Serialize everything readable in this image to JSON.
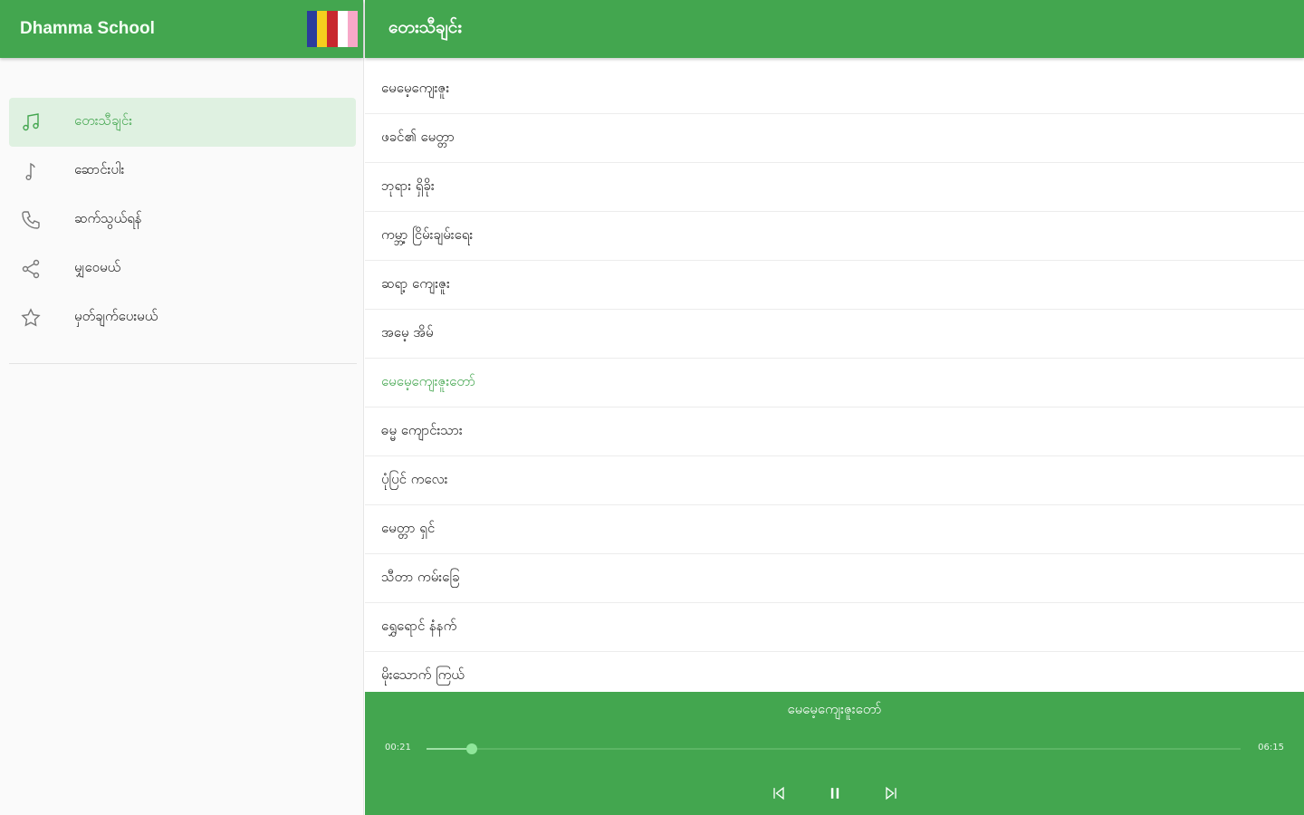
{
  "drawer": {
    "title": "Dhamma School",
    "flag_colors": [
      "#2b3c9c",
      "#f5cf1e",
      "#c8282e",
      "#ffffff",
      "#f7a8c8"
    ],
    "menu": [
      {
        "label": "တေးသီချင်း",
        "icon": "music-note-icon",
        "active": true
      },
      {
        "label": "ဆောင်းပါး",
        "icon": "single-note-icon",
        "active": false
      },
      {
        "label": "ဆက်သွယ်ရန်",
        "icon": "phone-icon",
        "active": false
      },
      {
        "label": "မျှဝေမယ်",
        "icon": "share-icon",
        "active": false
      },
      {
        "label": "မှတ်ချက်ပေးမယ်",
        "icon": "star-icon",
        "active": false
      }
    ]
  },
  "main": {
    "title": "တေးသီချင်း",
    "songs": [
      "မေမေ့ကျေးဇူး",
      "ဖခင်၏ မေတ္တာ",
      "ဘုရား ရှိခိုး",
      "ကမ္ဘာ့ ငြိမ်းချမ်းရေး",
      "ဆရာ့ ကျေးဇူး",
      "အမေ့ အိမ်",
      "မေမေ့ကျေးဇူးတော်",
      "ဓမ္မ ကျောင်းသား",
      "ပုံပြင် ကလေး",
      "မေတ္တာ ရှင်",
      "သီတာ ကမ်းခြေ",
      "ရွှေရောင် နံနက်",
      "မိုးသောက် ကြယ်"
    ],
    "playing_index": 6
  },
  "player": {
    "now_playing": "မေမေ့ကျေးဇူးတော်",
    "elapsed": "00:21",
    "total": "06:15",
    "progress": 0.056
  },
  "colors": {
    "primary": "#43a64f",
    "active_bg": "#dff1e1"
  }
}
